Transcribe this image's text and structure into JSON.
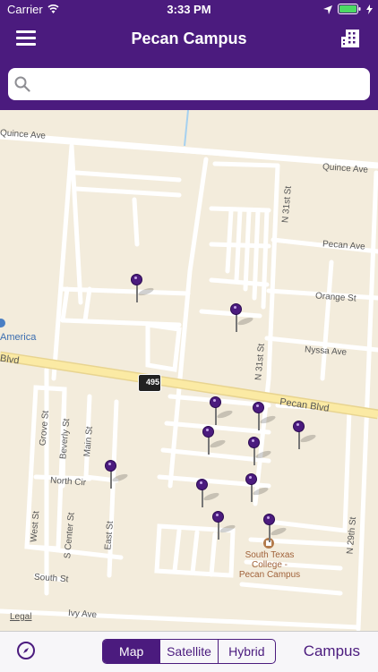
{
  "status_bar": {
    "carrier": "Carrier",
    "time": "3:33 PM"
  },
  "nav": {
    "title": "Pecan Campus",
    "menu_icon": "hamburger-menu-icon",
    "buildings_icon": "building-icon"
  },
  "search": {
    "value": "",
    "placeholder": ""
  },
  "map": {
    "streets": {
      "quince_ave_left": "Quince Ave",
      "quince_ave_right": "Quince Ave",
      "pecan_ave": "Pecan Ave",
      "orange_st": "Orange St",
      "nyssa_ave": "Nyssa Ave",
      "pecan_blvd_left": "Blvd",
      "pecan_blvd_right": "Pecan Blvd",
      "n31st_top": "N 31st St",
      "n31st_mid": "N 31st St",
      "n29th": "N 29th St",
      "grove_st": "Grove St",
      "beverly_st": "Beverly St",
      "main_st": "Main St",
      "north_cir": "North Cir",
      "west_st": "West St",
      "s_center_st": "S Center St",
      "east_st": "East St",
      "south_st": "South St",
      "ivy_ave": "Ivy Ave"
    },
    "highway_shield": "495",
    "poi_left": "America",
    "campus_label": [
      "South Texas",
      "College -",
      "Pecan Campus"
    ],
    "legal": "Legal",
    "pin_count": 13
  },
  "toolbar": {
    "map_types": [
      "Map",
      "Satellite",
      "Hybrid"
    ],
    "selected": "Map",
    "campus_button": "Campus"
  },
  "colors": {
    "brand": "#4b1b7e",
    "map_bg": "#f3ecdc",
    "road": "#ffffff",
    "highway": "#fbeaa4"
  }
}
